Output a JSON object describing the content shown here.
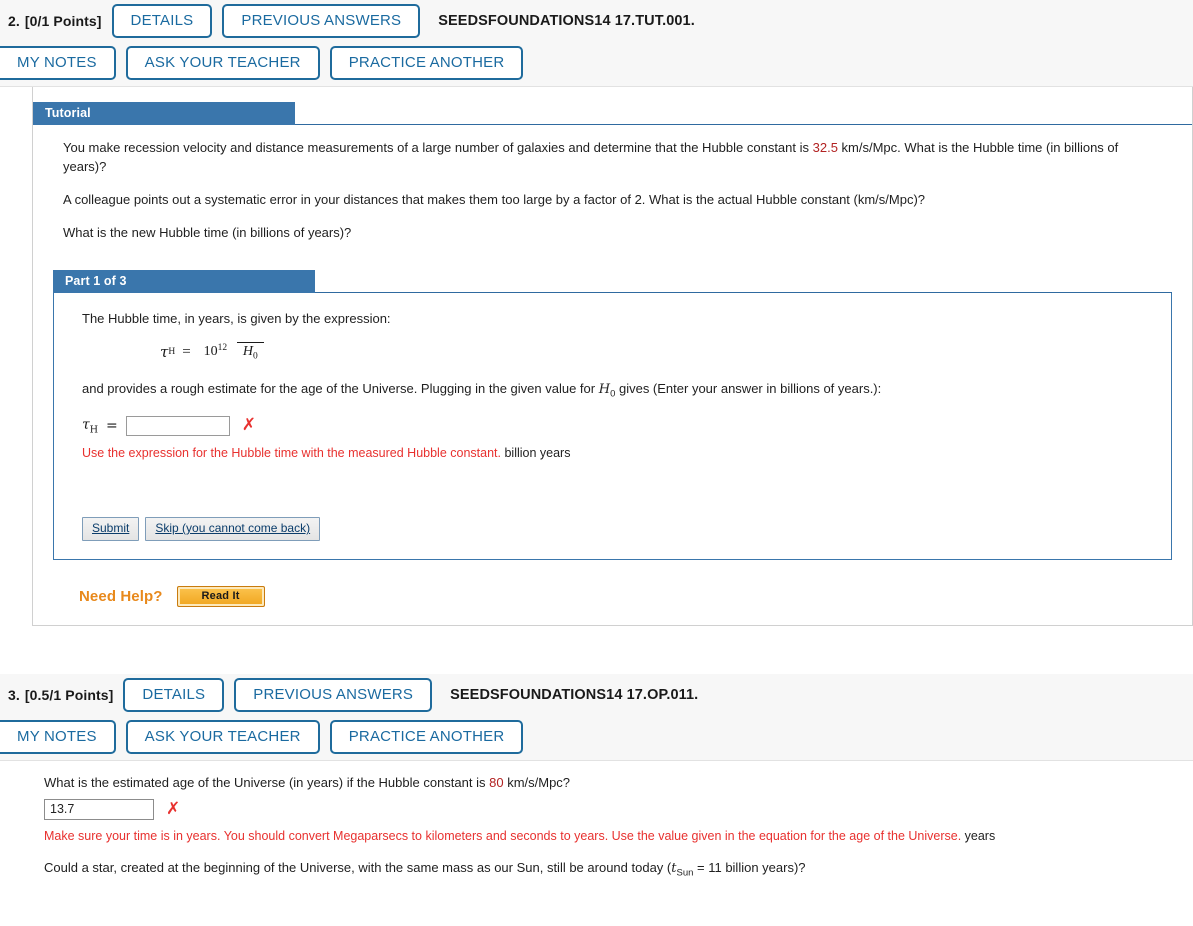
{
  "q2": {
    "number": "2.",
    "points": "[0/1 Points]",
    "details_label": "DETAILS",
    "previous_answers_label": "PREVIOUS ANSWERS",
    "title": "SEEDSFOUNDATIONS14 17.TUT.001.",
    "my_notes_label": "MY NOTES",
    "ask_teacher_label": "ASK YOUR TEACHER",
    "practice_another_label": "PRACTICE ANOTHER",
    "tutorial": {
      "caption": "Tutorial",
      "p1_before": "You make recession velocity and distance measurements of a large number of galaxies and determine that the Hubble constant is ",
      "p1_value": "32.5",
      "p1_after": " km/s/Mpc. What is the Hubble time (in billions of years)?",
      "p2": "A colleague points out a systematic error in your distances that makes them too large by a factor of 2. What is the actual Hubble constant (km/s/Mpc)?",
      "p3": "What is the new Hubble time (in billions of years)?"
    },
    "part1": {
      "caption": "Part 1 of 3",
      "intro": "The Hubble time, in years, is given by the expression:",
      "formula": {
        "lhs_symbol": "τ",
        "lhs_sub": "H",
        "equals": "=",
        "numerator_base": "10",
        "numerator_exp": "12",
        "denominator_symbol": "H",
        "denominator_sub": "0"
      },
      "after_before": "and provides a rough estimate for the age of the Universe. Plugging in the given value for ",
      "after_symbol": "H",
      "after_sub": "0",
      "after_rest": " gives (Enter your answer in billions of years.):",
      "answer_label_symbol": "τ",
      "answer_label_sub": "H",
      "answer_equals": "=",
      "answer_value": "",
      "answer_status_icon": "red-x-icon",
      "error_message": "Use the expression for the Hubble time with the measured Hubble constant.",
      "unit": "billion years",
      "submit_label": "Submit",
      "skip_label": "Skip (you cannot come back)"
    },
    "need_help": {
      "label": "Need Help?",
      "read_it_label": "Read It"
    }
  },
  "q3": {
    "number": "3.",
    "points": "[0.5/1 Points]",
    "details_label": "DETAILS",
    "previous_answers_label": "PREVIOUS ANSWERS",
    "title": "SEEDSFOUNDATIONS14 17.OP.011.",
    "my_notes_label": "MY NOTES",
    "ask_teacher_label": "ASK YOUR TEACHER",
    "practice_another_label": "PRACTICE ANOTHER",
    "question1_before": "What is the estimated age of the Universe (in years) if the Hubble constant is ",
    "question1_value": "80",
    "question1_after": " km/s/Mpc?",
    "answer_value": "13.7",
    "answer_status_icon": "red-x-icon",
    "error_message": "Make sure your time is in years. You should convert Megaparsecs to kilometers and seconds to years. Use the value given in the equation for the age of the Universe.",
    "unit": "years",
    "question2_before": "Could a star, created at the beginning of the Universe, with the same mass as our Sun, still be around today (",
    "question2_symbol": "t",
    "question2_sub": "Sun",
    "question2_after": " = 11 billion years)?"
  },
  "colors": {
    "button_blue": "#1f6b9c",
    "caption_blue": "#3a76ac",
    "error_red": "#e8312f",
    "highlight_red": "#b22222",
    "need_help_orange": "#e8891c"
  }
}
